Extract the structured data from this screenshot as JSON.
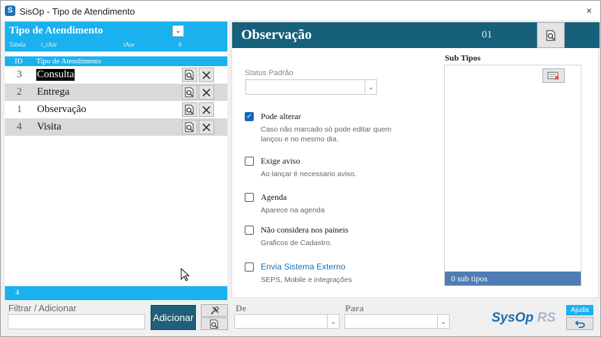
{
  "window": {
    "title": "SisOp - Tipo de Atendimento",
    "app_icon": "S",
    "close_glyph": "×"
  },
  "list_panel": {
    "title": "Tipo de Atendimento",
    "table_label": "Tabela",
    "table_name": "t_tAte",
    "table_alias": "tAte",
    "table_count": "0",
    "col_id": "ID",
    "col_name": "Tipo de Atendimento",
    "rows": [
      {
        "id": "3",
        "name": "Consulta"
      },
      {
        "id": "2",
        "name": "Entrega"
      },
      {
        "id": "1",
        "name": "Observação"
      },
      {
        "id": "4",
        "name": "Visita"
      }
    ],
    "footer_count": "4"
  },
  "detail": {
    "title": "Observação",
    "code": "01",
    "status_label": "Status Padrão",
    "status_value": "",
    "options": [
      {
        "label": "Pode alterar",
        "desc": "Caso não marcado só pode editar quem lançou e no mesmo dia.",
        "checked": true
      },
      {
        "label": "Exige aviso",
        "desc": "Ao lançar é necessario aviso.",
        "checked": false
      },
      {
        "label": "Agenda",
        "desc": "Aparece na agenda",
        "checked": false
      },
      {
        "label": "Não considera nos paineis",
        "desc": "Graficos de Cadastro.",
        "checked": false
      },
      {
        "label": "Envia Sistema Externo",
        "desc": "SEPS, Mobile e integrações",
        "checked": false
      }
    ],
    "subtypes_label": "Sub Tipos",
    "subtypes_footer": "0 sub tipos"
  },
  "bottom": {
    "filter_label": "Filtrar / Adicionar",
    "filter_value": "",
    "add_button": "Adicionar",
    "de_label": "De",
    "para_label": "Para",
    "logo_main": "SysOp",
    "logo_suffix": "RS",
    "help_button": "Ajuda"
  },
  "colors": {
    "list_header": "#1ab1ef",
    "detail_header": "#17607c",
    "add_button": "#1f5f79",
    "subtypes_footer": "#4f7db3",
    "checkbox_checked": "#1565c0"
  },
  "icons": [
    "view-record-icon",
    "delete-icon",
    "dropdown-arrow-icon",
    "checkmark-icon",
    "clear-list-icon",
    "tools-icon",
    "search-doc-icon",
    "undo-icon",
    "close-icon"
  ]
}
